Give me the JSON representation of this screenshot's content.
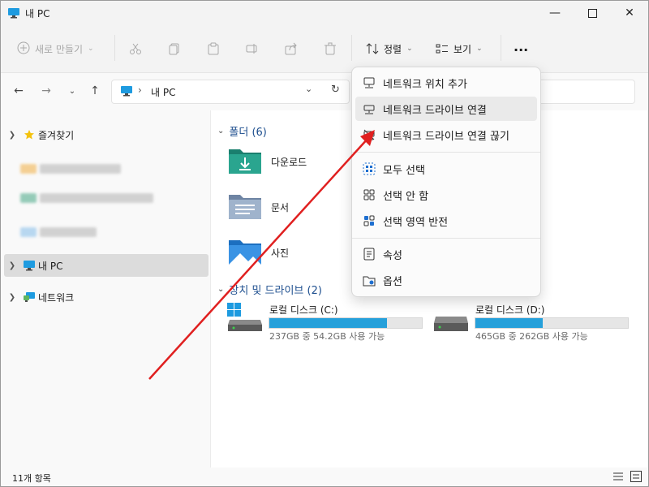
{
  "window": {
    "title": "내 PC"
  },
  "toolbar": {
    "new_label": "새로 만들기",
    "sort_label": "정렬",
    "view_label": "보기",
    "more_label": "..."
  },
  "address": {
    "path_label": "내 PC"
  },
  "sidebar": {
    "favorites_label": "즐겨찾기",
    "this_pc_label": "내 PC",
    "network_label": "네트워크"
  },
  "main": {
    "folders_header": "폴더 (6)",
    "folders": [
      {
        "name": "다운로드",
        "icon": "download-folder-icon"
      },
      {
        "name": "문서",
        "icon": "documents-folder-icon"
      },
      {
        "name": "사진",
        "icon": "pictures-folder-icon"
      }
    ],
    "drives_header": "장치 및 드라이브 (2)",
    "drives": [
      {
        "name": "로컬 디스크 (C:)",
        "usage": "237GB 중 54.2GB 사용 가능",
        "fill_fraction": 0.77
      },
      {
        "name": "로컬 디스크 (D:)",
        "usage": "465GB 중 262GB 사용 가능",
        "fill_fraction": 0.44
      }
    ]
  },
  "menu": {
    "items": [
      {
        "label": "네트워크 위치 추가",
        "icon": "network-location-icon"
      },
      {
        "label": "네트워크 드라이브 연결",
        "icon": "map-network-drive-icon"
      },
      {
        "label": "네트워크 드라이브 연결 끊기",
        "icon": "disconnect-network-drive-icon"
      },
      {
        "label": "모두 선택",
        "icon": "select-all-icon"
      },
      {
        "label": "선택 안 함",
        "icon": "select-none-icon"
      },
      {
        "label": "선택 영역 반전",
        "icon": "invert-selection-icon"
      },
      {
        "label": "속성",
        "icon": "properties-icon"
      },
      {
        "label": "옵션",
        "icon": "options-icon"
      }
    ]
  },
  "status": {
    "item_count": "11개 항목"
  },
  "colors": {
    "accent": "#26a0da",
    "folder_header": "#1e4f8f",
    "annotation_arrow": "#e02020"
  }
}
